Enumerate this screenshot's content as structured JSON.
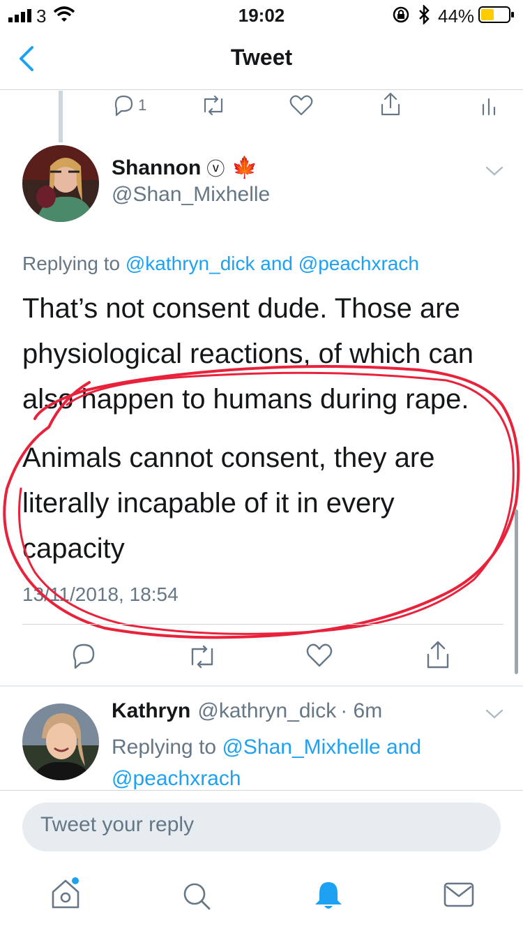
{
  "status_bar": {
    "carrier": "3",
    "time": "19:02",
    "battery": "44%"
  },
  "nav": {
    "title": "Tweet"
  },
  "prev_tweet_actions": {
    "reply_count": "1"
  },
  "main_tweet": {
    "name": "Shannon",
    "verified_glyph": "ⓥ",
    "emoji": "🍁",
    "handle": "@Shan_Mixhelle",
    "replying_prefix": "Replying to",
    "replying_user1": "@kathryn_dick",
    "replying_and": "and",
    "replying_user2": "@peachxrach",
    "paragraph1": "That’s not consent dude. Those are physiological reactions, of which can also happen to humans during rape.",
    "paragraph2": "Animals cannot consent, they are literally incapable of it in every capacity",
    "timestamp": "13/11/2018, 18:54"
  },
  "reply_tweet": {
    "name": "Kathryn",
    "handle": "@kathryn_dick",
    "time": "· 6m",
    "replying_prefix": "Replying to",
    "replying_user1": "@Shan_Mixhelle",
    "replying_and": "and",
    "replying_user2": "@peachxrach"
  },
  "reply_input": {
    "placeholder": "Tweet your reply"
  },
  "tab_bar": [
    "home-icon",
    "search-icon",
    "notifications-icon",
    "messages-icon"
  ],
  "colors": {
    "accent": "#1da1f2",
    "annotation": "#e8223a",
    "muted": "#657786"
  }
}
